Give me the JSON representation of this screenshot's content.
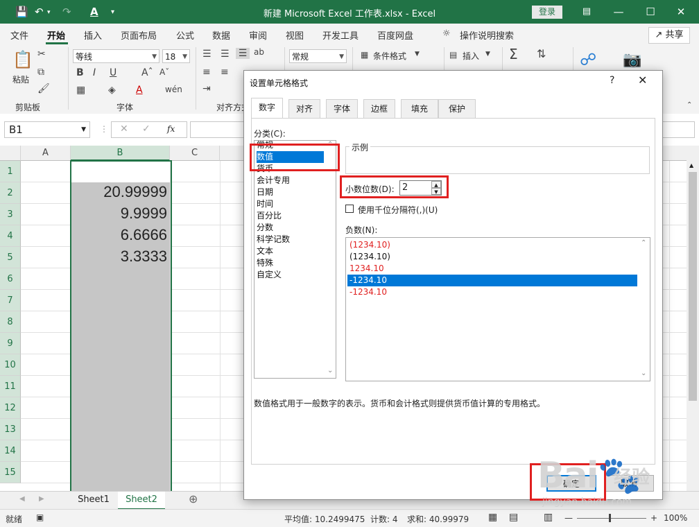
{
  "title_bar": {
    "title": "新建 Microsoft Excel 工作表.xlsx  -  Excel",
    "login": "登录"
  },
  "ribbon_tabs": [
    "文件",
    "开始",
    "插入",
    "页面布局",
    "公式",
    "数据",
    "审阅",
    "视图",
    "开发工具",
    "百度网盘"
  ],
  "tell_me": "操作说明搜索",
  "share": "共享",
  "ribbon": {
    "paste": "粘贴",
    "clipboard_group": "剪贴板",
    "font_name": "等线",
    "font_size": "18",
    "font_group": "字体",
    "align_group": "对齐方式",
    "number_format": "常规",
    "conditional_format": "条件格式",
    "insert": "插入"
  },
  "formula_bar": {
    "name_box": "B1",
    "fx": "fx"
  },
  "columns": [
    "A",
    "B",
    "C"
  ],
  "rows": [
    "1",
    "2",
    "3",
    "4",
    "5",
    "6",
    "7",
    "8",
    "9",
    "10",
    "11",
    "12",
    "13",
    "14",
    "15"
  ],
  "cells_b": [
    "",
    "20.99999",
    "9.9999",
    "6.6666",
    "3.3333"
  ],
  "sheets": [
    "Sheet1",
    "Sheet2"
  ],
  "status": {
    "ready": "就绪",
    "average": "平均值: 10.2499475",
    "count": "计数: 4",
    "sum": "求和: 40.99979",
    "zoom": "100%"
  },
  "dialog": {
    "title": "设置单元格格式",
    "help": "?",
    "tabs": [
      "数字",
      "对齐",
      "字体",
      "边框",
      "填充",
      "保护"
    ],
    "category_label": "分类(C):",
    "categories": [
      "常规",
      "数值",
      "货币",
      "会计专用",
      "日期",
      "时间",
      "百分比",
      "分数",
      "科学记数",
      "文本",
      "特殊",
      "自定义"
    ],
    "selected_category": "数值",
    "sample_label": "示例",
    "decimal_label": "小数位数(D):",
    "decimal_value": "2",
    "thousands_label": "使用千位分隔符(,)(U)",
    "negative_label": "负数(N):",
    "negatives": [
      "(1234.10)",
      "(1234.10)",
      "1234.10",
      "-1234.10",
      "-1234.10"
    ],
    "negative_colors": [
      "#e02020",
      "#111111",
      "#e02020",
      "#ffffff",
      "#e02020"
    ],
    "description": "数值格式用于一般数字的表示。货币和会计格式则提供货币值计算的专用格式。",
    "ok": "确定",
    "cancel": "取消"
  },
  "watermark": {
    "site": "jingyan.baidu.com"
  },
  "colors": {
    "excel_green": "#217346",
    "highlight_red": "#e02020",
    "select_blue": "#0078d7"
  }
}
